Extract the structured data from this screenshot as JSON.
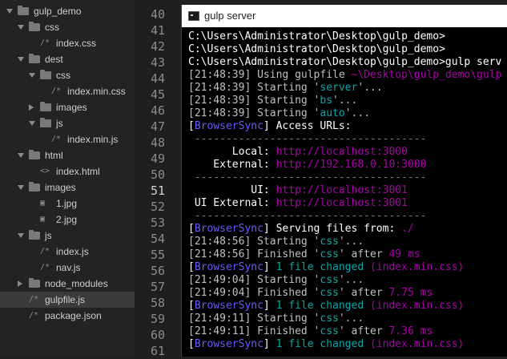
{
  "sidebar": {
    "items": [
      {
        "label": "gulp_demo",
        "kind": "folder",
        "expanded": true,
        "depth": 0
      },
      {
        "label": "css",
        "kind": "folder",
        "expanded": true,
        "depth": 1
      },
      {
        "label": "index.css",
        "kind": "file",
        "icon": "css-file-icon",
        "depth": 2
      },
      {
        "label": "dest",
        "kind": "folder",
        "expanded": true,
        "depth": 1
      },
      {
        "label": "css",
        "kind": "folder",
        "expanded": true,
        "depth": 2
      },
      {
        "label": "index.min.css",
        "kind": "file",
        "icon": "css-file-icon",
        "depth": 3
      },
      {
        "label": "images",
        "kind": "folder",
        "expanded": false,
        "depth": 2
      },
      {
        "label": "js",
        "kind": "folder",
        "expanded": true,
        "depth": 2
      },
      {
        "label": "index.min.js",
        "kind": "file",
        "icon": "js-file-icon",
        "depth": 3
      },
      {
        "label": "html",
        "kind": "folder",
        "expanded": true,
        "depth": 1
      },
      {
        "label": "index.html",
        "kind": "file",
        "icon": "html-file-icon",
        "depth": 2
      },
      {
        "label": "images",
        "kind": "folder",
        "expanded": true,
        "depth": 1
      },
      {
        "label": "1.jpg",
        "kind": "file",
        "icon": "image-file-icon",
        "depth": 2
      },
      {
        "label": "2.jpg",
        "kind": "file",
        "icon": "image-file-icon",
        "depth": 2
      },
      {
        "label": "js",
        "kind": "folder",
        "expanded": true,
        "depth": 1
      },
      {
        "label": "index.js",
        "kind": "file",
        "icon": "js-file-icon",
        "depth": 2
      },
      {
        "label": "nav.js",
        "kind": "file",
        "icon": "js-file-icon",
        "depth": 2
      },
      {
        "label": "node_modules",
        "kind": "folder",
        "expanded": false,
        "depth": 1
      },
      {
        "label": "gulpfile.js",
        "kind": "file",
        "icon": "js-file-icon",
        "depth": 1,
        "active": true
      },
      {
        "label": "package.json",
        "kind": "file",
        "icon": "json-file-icon",
        "depth": 1
      }
    ]
  },
  "gutter": {
    "lines": [
      "40",
      "41",
      "42",
      "43",
      "44",
      "45",
      "46",
      "47",
      "48",
      "49",
      "50",
      "51",
      "52",
      "53",
      "54",
      "55",
      "56",
      "57",
      "58",
      "59",
      "60",
      "61"
    ],
    "current_line": "51"
  },
  "terminal": {
    "title": "gulp server",
    "lines": [
      [
        {
          "t": "C:\\Users\\Administrator\\Desktop\\gulp_demo>",
          "c": "white"
        }
      ],
      [
        {
          "t": "C:\\Users\\Administrator\\Desktop\\gulp_demo>",
          "c": "white"
        }
      ],
      [
        {
          "t": "C:\\Users\\Administrator\\Desktop\\gulp_demo>gulp serv",
          "c": "white"
        }
      ],
      [
        {
          "t": "[",
          "c": "gray"
        },
        {
          "t": "21:48:39",
          "c": "gray"
        },
        {
          "t": "] Using gulpfile ",
          "c": "gray"
        },
        {
          "t": "~\\Desktop\\gulp_demo\\gulp",
          "c": "magenta"
        }
      ],
      [
        {
          "t": "[",
          "c": "gray"
        },
        {
          "t": "21:48:39",
          "c": "gray"
        },
        {
          "t": "] Starting '",
          "c": "gray"
        },
        {
          "t": "server",
          "c": "cyan"
        },
        {
          "t": "'...",
          "c": "gray"
        }
      ],
      [
        {
          "t": "[",
          "c": "gray"
        },
        {
          "t": "21:48:39",
          "c": "gray"
        },
        {
          "t": "] Starting '",
          "c": "gray"
        },
        {
          "t": "bs",
          "c": "cyan"
        },
        {
          "t": "'...",
          "c": "gray"
        }
      ],
      [
        {
          "t": "[",
          "c": "gray"
        },
        {
          "t": "21:48:39",
          "c": "gray"
        },
        {
          "t": "] Starting '",
          "c": "gray"
        },
        {
          "t": "auto",
          "c": "cyan"
        },
        {
          "t": "'...",
          "c": "gray"
        }
      ],
      [
        {
          "t": "[",
          "c": "white"
        },
        {
          "t": "BrowserSync",
          "c": "blue"
        },
        {
          "t": "] Access URLs:",
          "c": "white"
        }
      ],
      [
        {
          "t": " -------------------------------------",
          "c": "dash"
        }
      ],
      [
        {
          "t": "       Local: ",
          "c": "white"
        },
        {
          "t": "http://localhost:3000",
          "c": "magenta"
        }
      ],
      [
        {
          "t": "    External: ",
          "c": "white"
        },
        {
          "t": "http://192.168.0.10:3000",
          "c": "magenta"
        }
      ],
      [
        {
          "t": " -------------------------------------",
          "c": "dash"
        }
      ],
      [
        {
          "t": "          UI: ",
          "c": "white"
        },
        {
          "t": "http://localhost:3001",
          "c": "magenta"
        }
      ],
      [
        {
          "t": " UI External: ",
          "c": "white"
        },
        {
          "t": "http://localhost:3001",
          "c": "magenta"
        }
      ],
      [
        {
          "t": " -------------------------------------",
          "c": "dash"
        }
      ],
      [
        {
          "t": "[",
          "c": "white"
        },
        {
          "t": "BrowserSync",
          "c": "blue"
        },
        {
          "t": "] Serving files from: ",
          "c": "white"
        },
        {
          "t": "./",
          "c": "magenta"
        }
      ],
      [
        {
          "t": "[",
          "c": "gray"
        },
        {
          "t": "21:48:56",
          "c": "gray"
        },
        {
          "t": "] Starting '",
          "c": "gray"
        },
        {
          "t": "css",
          "c": "cyan"
        },
        {
          "t": "'...",
          "c": "gray"
        }
      ],
      [
        {
          "t": "[",
          "c": "gray"
        },
        {
          "t": "21:48:56",
          "c": "gray"
        },
        {
          "t": "] Finished '",
          "c": "gray"
        },
        {
          "t": "css",
          "c": "cyan"
        },
        {
          "t": "' after ",
          "c": "gray"
        },
        {
          "t": "49 ms",
          "c": "magenta"
        }
      ],
      [
        {
          "t": "[",
          "c": "white"
        },
        {
          "t": "BrowserSync",
          "c": "blue"
        },
        {
          "t": "] ",
          "c": "white"
        },
        {
          "t": "1 file changed ",
          "c": "cyan"
        },
        {
          "t": "(index.min.css)",
          "c": "magenta"
        }
      ],
      [
        {
          "t": "[",
          "c": "gray"
        },
        {
          "t": "21:49:04",
          "c": "gray"
        },
        {
          "t": "] Starting '",
          "c": "gray"
        },
        {
          "t": "css",
          "c": "cyan"
        },
        {
          "t": "'...",
          "c": "gray"
        }
      ],
      [
        {
          "t": "[",
          "c": "gray"
        },
        {
          "t": "21:49:04",
          "c": "gray"
        },
        {
          "t": "] Finished '",
          "c": "gray"
        },
        {
          "t": "css",
          "c": "cyan"
        },
        {
          "t": "' after ",
          "c": "gray"
        },
        {
          "t": "7.75 ms",
          "c": "magenta"
        }
      ],
      [
        {
          "t": "[",
          "c": "white"
        },
        {
          "t": "BrowserSync",
          "c": "blue"
        },
        {
          "t": "] ",
          "c": "white"
        },
        {
          "t": "1 file changed ",
          "c": "cyan"
        },
        {
          "t": "(index.min.css)",
          "c": "magenta"
        }
      ],
      [
        {
          "t": "[",
          "c": "gray"
        },
        {
          "t": "21:49:11",
          "c": "gray"
        },
        {
          "t": "] Starting '",
          "c": "gray"
        },
        {
          "t": "css",
          "c": "cyan"
        },
        {
          "t": "'...",
          "c": "gray"
        }
      ],
      [
        {
          "t": "[",
          "c": "gray"
        },
        {
          "t": "21:49:11",
          "c": "gray"
        },
        {
          "t": "] Finished '",
          "c": "gray"
        },
        {
          "t": "css",
          "c": "cyan"
        },
        {
          "t": "' after ",
          "c": "gray"
        },
        {
          "t": "7.36 ms",
          "c": "magenta"
        }
      ],
      [
        {
          "t": "[",
          "c": "white"
        },
        {
          "t": "BrowserSync",
          "c": "blue"
        },
        {
          "t": "] ",
          "c": "white"
        },
        {
          "t": "1 file changed ",
          "c": "cyan"
        },
        {
          "t": "(index.min.css)",
          "c": "magenta"
        }
      ]
    ]
  },
  "colors": {
    "sidebar_bg": "#232323",
    "editor_bg": "#1f1f20",
    "terminal_bg": "#000000",
    "ansi_cyan": "#00aaaa",
    "ansi_magenta": "#aa00aa",
    "ansi_blue": "#5f5fff"
  }
}
